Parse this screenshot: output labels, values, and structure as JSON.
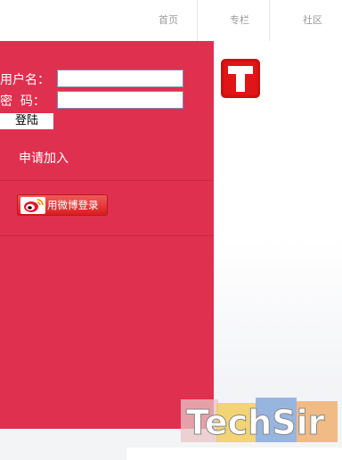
{
  "nav": {
    "items": [
      {
        "label": "首页"
      },
      {
        "label": "专栏"
      },
      {
        "label": "社区"
      }
    ]
  },
  "login": {
    "username_label": "用户名：",
    "password_label": "密  码：",
    "username_value": "",
    "password_value": "",
    "submit_label": "登陆",
    "join_label": "申请加入",
    "weibo_label": "用微博登录"
  },
  "brand": {
    "logo_letter": "T",
    "watermark_text": "TechSir"
  },
  "colors": {
    "panel": "#e0304f",
    "logo": "#cc1111"
  }
}
